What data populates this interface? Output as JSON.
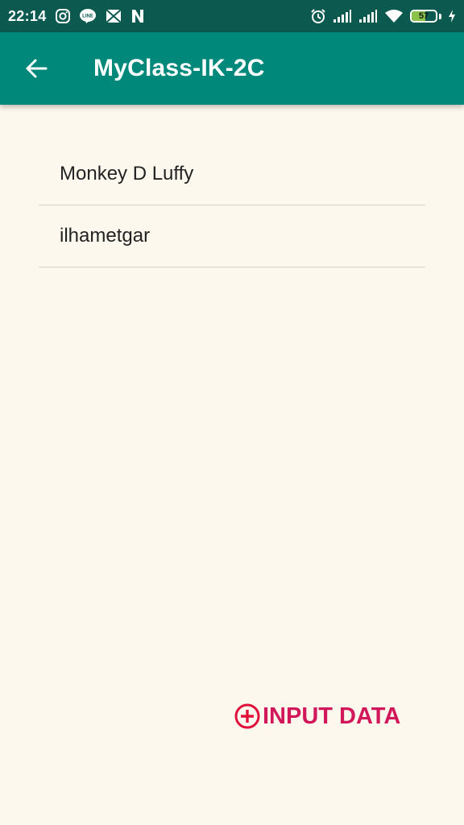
{
  "status_bar": {
    "time": "22:14",
    "left_icons": [
      "instagram-icon",
      "line-icon",
      "mail-icon",
      "n-icon"
    ],
    "right_icons": [
      "alarm-icon",
      "signal-icon",
      "signal-icon",
      "wifi-icon",
      "charging-icon"
    ],
    "battery_level": "57"
  },
  "app_bar": {
    "title": "MyClass-IK-2C",
    "back_icon": "arrow-back-icon"
  },
  "list": {
    "items": [
      {
        "label": "Monkey D Luffy"
      },
      {
        "label": "ilhametgar"
      }
    ]
  },
  "actions": {
    "input_data_label": "INPUT DATA",
    "input_data_icon": "add-circle-icon",
    "accent_color": "#d0185a"
  },
  "colors": {
    "status_bar": "#0c5a4f",
    "app_bar": "#00897b",
    "background": "#fdf8ee"
  }
}
